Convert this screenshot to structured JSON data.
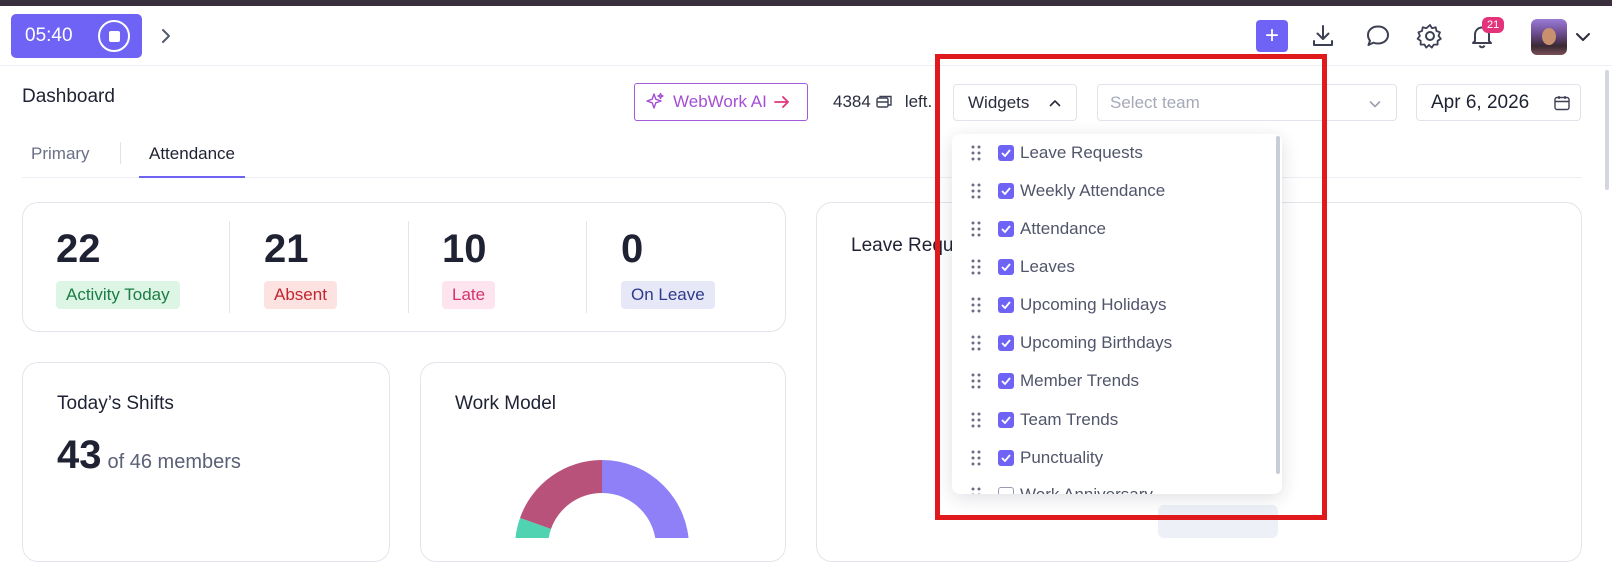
{
  "topbar": {
    "timer": "05:40",
    "notifications_count": "21",
    "icons": [
      "stop-icon",
      "chevron-right-icon",
      "plus-icon",
      "download-icon",
      "chat-icon",
      "gear-icon",
      "bell-icon",
      "avatar",
      "chevron-down-icon"
    ]
  },
  "header": {
    "title": "Dashboard",
    "ai_button": "WebWork AI",
    "credits_value": "4384",
    "credits_suffix": "left.",
    "widgets_label": "Widgets",
    "team_placeholder": "Select team",
    "date": "Apr 6, 2026"
  },
  "tabs": [
    {
      "label": "Primary",
      "active": false
    },
    {
      "label": "Attendance",
      "active": true
    }
  ],
  "stats": [
    {
      "value": "22",
      "label": "Activity Today",
      "fg": "#1b7d45",
      "bg": "#dcf5e5"
    },
    {
      "value": "21",
      "label": "Absent",
      "fg": "#c0262d",
      "bg": "#fde2e2"
    },
    {
      "value": "10",
      "label": "Late",
      "fg": "#d6336c",
      "bg": "#fde4ee"
    },
    {
      "value": "0",
      "label": "On Leave",
      "fg": "#2f3a8a",
      "bg": "#e6e8f8"
    }
  ],
  "shifts": {
    "title": "Today’s Shifts",
    "count": "43",
    "suffix": "of 46 members"
  },
  "work_model": {
    "title": "Work Model",
    "colors": [
      "#8f80f7",
      "#b9527a",
      "#4fd3b0"
    ]
  },
  "leave_card": {
    "title": "Leave Requ"
  },
  "widgets_dropdown": {
    "items": [
      {
        "label": "Leave Requests",
        "checked": true
      },
      {
        "label": "Weekly Attendance",
        "checked": true
      },
      {
        "label": "Attendance",
        "checked": true
      },
      {
        "label": "Leaves",
        "checked": true
      },
      {
        "label": "Upcoming Holidays",
        "checked": true
      },
      {
        "label": "Upcoming Birthdays",
        "checked": true
      },
      {
        "label": "Member Trends",
        "checked": true
      },
      {
        "label": "Team Trends",
        "checked": true
      },
      {
        "label": "Punctuality",
        "checked": true
      },
      {
        "label": "Work Anniversary",
        "checked": false
      }
    ]
  },
  "colors": {
    "accent": "#6f63f5",
    "highlight": "#e0191d"
  }
}
